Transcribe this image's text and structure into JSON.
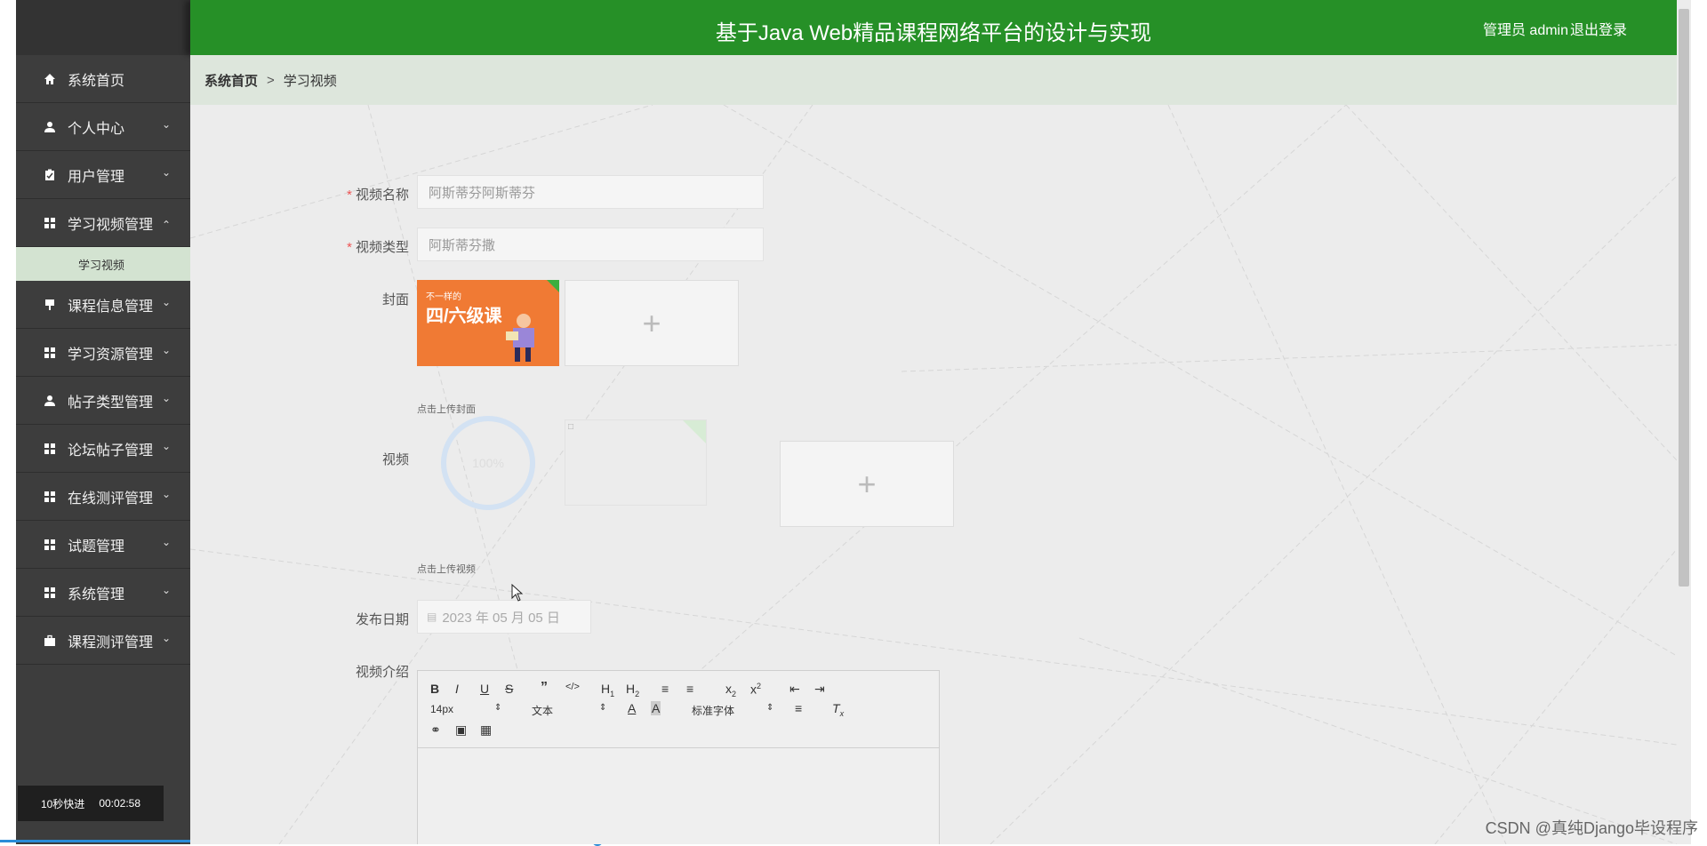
{
  "header": {
    "title": "基于Java Web精品课程网络平台的设计与实现",
    "user_label": "管理员 admin",
    "logout_label": "退出登录"
  },
  "sidebar": {
    "items": [
      {
        "label": "系统首页",
        "icon": "home-icon",
        "expandable": false
      },
      {
        "label": "个人中心",
        "icon": "user-icon",
        "expandable": true
      },
      {
        "label": "用户管理",
        "icon": "clipboard-icon",
        "expandable": true
      },
      {
        "label": "学习视频管理",
        "icon": "grid-icon",
        "expandable": true,
        "expanded": true
      },
      {
        "label": "课程信息管理",
        "icon": "flag-icon",
        "expandable": true
      },
      {
        "label": "学习资源管理",
        "icon": "grid-icon",
        "expandable": true
      },
      {
        "label": "帖子类型管理",
        "icon": "user-icon",
        "expandable": true
      },
      {
        "label": "论坛帖子管理",
        "icon": "grid-icon",
        "expandable": true
      },
      {
        "label": "在线测评管理",
        "icon": "grid-icon",
        "expandable": true
      },
      {
        "label": "试题管理",
        "icon": "grid-icon",
        "expandable": true
      },
      {
        "label": "系统管理",
        "icon": "grid-icon",
        "expandable": true
      },
      {
        "label": "课程测评管理",
        "icon": "briefcase-icon",
        "expandable": true
      }
    ],
    "subitem_label": "学习视频"
  },
  "breadcrumb": {
    "home": "系统首页",
    "separator": ">",
    "current": "学习视频"
  },
  "form": {
    "video_name_label": "视频名称",
    "video_name_value": "阿斯蒂芬阿斯蒂芬",
    "video_type_label": "视频类型",
    "video_type_value": "阿斯蒂芬撒",
    "cover_label": "封面",
    "cover_thumb_text_top": "不一样的",
    "cover_thumb_text_main": "四/六级课",
    "cover_hint": "点击上传封面",
    "video_label": "视频",
    "video_progress": "100%",
    "video_hint": "点击上传视频",
    "date_label": "发布日期",
    "date_value": "2023 年 05 月 05 日",
    "intro_label": "视频介绍",
    "upload_plus": "+"
  },
  "editor": {
    "font_size": "14px",
    "block_type": "文本",
    "font_family": "标准字体"
  },
  "player": {
    "skip_label": "10秒快进",
    "time": "00:02:58",
    "progress": 0.35
  },
  "watermark": "CSDN @真纯Django毕设程序"
}
